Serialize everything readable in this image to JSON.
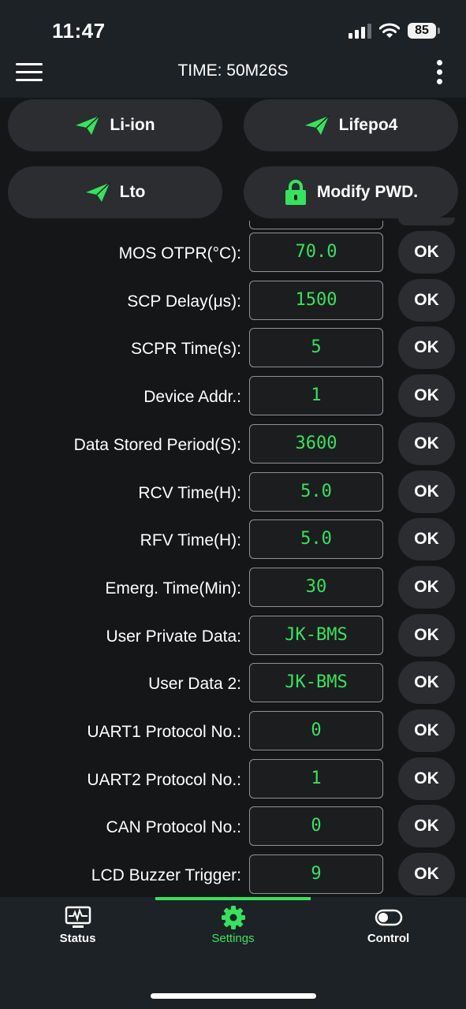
{
  "status_bar": {
    "time": "11:47",
    "battery": "85"
  },
  "app_bar": {
    "title": "TIME: 50M26S"
  },
  "presets": [
    {
      "label": "Li-ion",
      "icon": "paper-plane-icon"
    },
    {
      "label": "Lifepo4",
      "icon": "paper-plane-icon"
    },
    {
      "label": "Lto",
      "icon": "paper-plane-icon"
    },
    {
      "label": "Modify PWD.",
      "icon": "lock-icon"
    }
  ],
  "settings": [
    {
      "label": "MOS OTPR(°C):",
      "value": "70.0",
      "button": "OK"
    },
    {
      "label": "SCP Delay(μs):",
      "value": "1500",
      "button": "OK"
    },
    {
      "label": "SCPR Time(s):",
      "value": "5",
      "button": "OK"
    },
    {
      "label": "Device Addr.:",
      "value": "1",
      "button": "OK"
    },
    {
      "label": "Data Stored Period(S):",
      "value": "3600",
      "button": "OK"
    },
    {
      "label": "RCV Time(H):",
      "value": "5.0",
      "button": "OK"
    },
    {
      "label": "RFV Time(H):",
      "value": "5.0",
      "button": "OK"
    },
    {
      "label": "Emerg. Time(Min):",
      "value": "30",
      "button": "OK"
    },
    {
      "label": "User Private Data:",
      "value": "JK-BMS",
      "button": "OK"
    },
    {
      "label": "User Data 2:",
      "value": "JK-BMS",
      "button": "OK"
    },
    {
      "label": "UART1 Protocol No.:",
      "value": "0",
      "button": "OK"
    },
    {
      "label": "UART2 Protocol No.:",
      "value": "1",
      "button": "OK"
    },
    {
      "label": "CAN Protocol No.:",
      "value": "0",
      "button": "OK"
    },
    {
      "label": "LCD Buzzer Trigger:",
      "value": "9",
      "button": "OK"
    }
  ],
  "bottom_nav": [
    {
      "label": "Status",
      "icon": "monitor-pulse-icon",
      "active": false
    },
    {
      "label": "Settings",
      "icon": "gear-icon",
      "active": true
    },
    {
      "label": "Control",
      "icon": "toggle-icon",
      "active": false
    }
  ],
  "colors": {
    "accent": "#35e35d",
    "surface": "#2b2d30",
    "background": "#141618",
    "bar": "#1c2226"
  }
}
